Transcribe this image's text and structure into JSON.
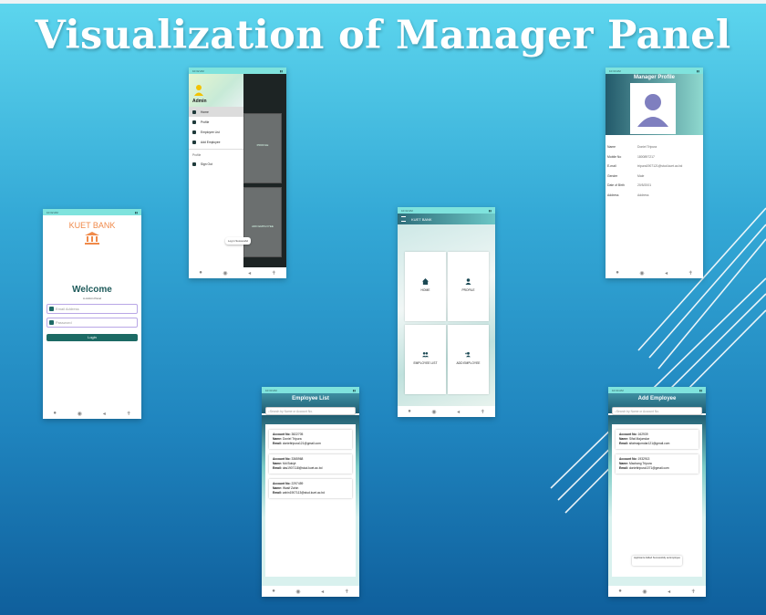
{
  "slide": {
    "title": "Visualization of Manager Panel"
  },
  "login": {
    "status": "10:32 AM",
    "brand": "KUET BANK",
    "welcome": "Welcome",
    "subtitle": "to Admin Panel",
    "email_placeholder": "Email Address",
    "password_placeholder": "Password",
    "login_button": "Login"
  },
  "drawer": {
    "status": "10:32 AM",
    "admin_label": "Admin",
    "items": [
      {
        "label": "Home",
        "icon": "home-icon"
      },
      {
        "label": "Profile",
        "icon": "person-icon"
      },
      {
        "label": "Employee List",
        "icon": "group-icon"
      },
      {
        "label": "Add Employee",
        "icon": "person-add-icon"
      }
    ],
    "section_label": "Profile",
    "signout_label": "Sign Out",
    "bg_profile_label": "PROFILE",
    "bg_add_label": "ADD EMPLOYEE",
    "toast": "Log in Successful"
  },
  "profile": {
    "status": "10:33 AM",
    "title": "Manager Profile",
    "fields": [
      {
        "key": "Name",
        "value": "Doniel Tripura"
      },
      {
        "key": "Mobile No",
        "value": "1800897217"
      },
      {
        "key": "E-mail",
        "value": "tripura1907121@stud.kuet.ac.bd"
      },
      {
        "key": "Gender",
        "value": "Male"
      },
      {
        "key": "Date of Birth",
        "value": "20/5/2001"
      },
      {
        "key": "Address",
        "value": "Address"
      }
    ]
  },
  "dashboard": {
    "status": "10:32 AM",
    "appbar_title": "KUET BANK",
    "tiles": [
      {
        "label": "HOME",
        "icon": "home-icon"
      },
      {
        "label": "PROFILE",
        "icon": "person-icon"
      },
      {
        "label": "EMPLOYEE LIST",
        "icon": "group-icon"
      },
      {
        "label": "ADD EMPLOYEE",
        "icon": "person-add-icon"
      }
    ]
  },
  "employee_list": {
    "status": "10:33 AM",
    "title": "Employee List",
    "search_placeholder": "Search by Name or Account No.",
    "labels": {
      "account": "Account No:",
      "name": "Name:",
      "email": "Email:"
    },
    "employees": [
      {
        "account": "3822705",
        "name": "Doniel Tripura",
        "email": "donieltripura121@gmail.com"
      },
      {
        "account": "3365968",
        "name": "Md Bokiyt",
        "email": "das1907118@stud.kuet.ac.bd"
      },
      {
        "account": "2297459",
        "name": "Wasif Zahin",
        "email": "zahin1907113@stud.kuet.ac.bd"
      }
    ]
  },
  "add_employee": {
    "status": "10:34 AM",
    "title": "Add Employee",
    "search_placeholder": "Search by Name or Account No.",
    "labels": {
      "account": "Account No:",
      "name": "Name:",
      "email": "Email:"
    },
    "candidates": [
      {
        "account": "162939",
        "name": "Sifat Majumdar",
        "email": "sifatmajumdar121@gmail.com"
      },
      {
        "account": "1932913",
        "name": "Machang Tripura",
        "email": "donieltripura1071@gmail.com"
      }
    ],
    "snackbar": "Applicants Added Successfully as Employee"
  },
  "colors": {
    "accent_teal": "#1c6a64",
    "brand_orange": "#f08a4a",
    "header_teal": "#1d5c72"
  }
}
